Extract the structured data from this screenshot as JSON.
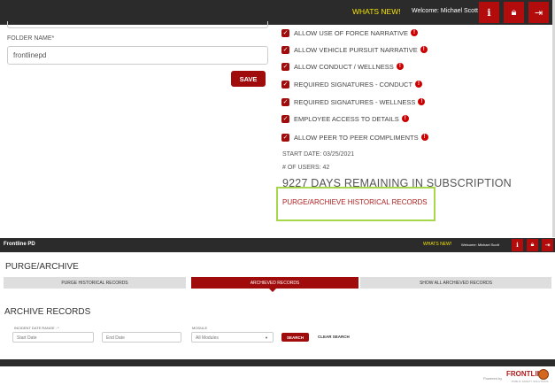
{
  "top": {
    "whats_new": "WHATS NEW!",
    "welcome": "Welcome: Michael Scott",
    "icons": [
      "info-icon",
      "lock-icon",
      "logout-icon"
    ]
  },
  "form": {
    "folder_label": "FOLDER NAME*",
    "folder_value": "frontlinepd",
    "save_label": "SAVE"
  },
  "options": [
    "ALLOW USE OF FORCE NARRATIVE",
    "ALLOW VEHICLE PURSUIT NARRATIVE",
    "ALLOW CONDUCT / WELLNESS",
    "REQUIRED SIGNATURES - CONDUCT",
    "REQUIRED SIGNATURES - WELLNESS",
    "EMPLOYEE ACCESS TO DETAILS",
    "ALLOW PEER TO PEER COMPLIMENTS"
  ],
  "subscription": {
    "start_date": "START DATE: 03/25/2021",
    "users": "# OF USERS: 42",
    "days_remaining": "9227 DAYS REMAINING IN SUBSCRIPTION",
    "purge_link": "PURGE/ARCHIEVE HISTORICAL RECORDS"
  },
  "lower_bar": {
    "brand": "Frontline PD",
    "whats_new": "WHATS NEW!",
    "welcome": "Welcome: Michael Scott"
  },
  "purge": {
    "title": "PURGE/ARCHIVE",
    "tabs": [
      "PURGE HISTORICAL RECORDS",
      "ARCHIEVED RECORDS",
      "SHOW ALL ARCHIEVED RECORDS"
    ],
    "active_tab": 1
  },
  "archive": {
    "title": "ARCHIVE RECORDS",
    "date_label": "INCIDENT DATE RANGE : *",
    "start_placeholder": "Start Date",
    "end_placeholder": "End Date",
    "module_label": "MODULE",
    "module_value": "All Modules",
    "search_label": "SEARCH",
    "clear_label": "CLEAR SEARCH"
  },
  "footer": {
    "powered_by": "Powered by",
    "logo_text": "FRONTLINE",
    "logo_sub": "PUBLIC SAFETY SOLUTIONS"
  }
}
